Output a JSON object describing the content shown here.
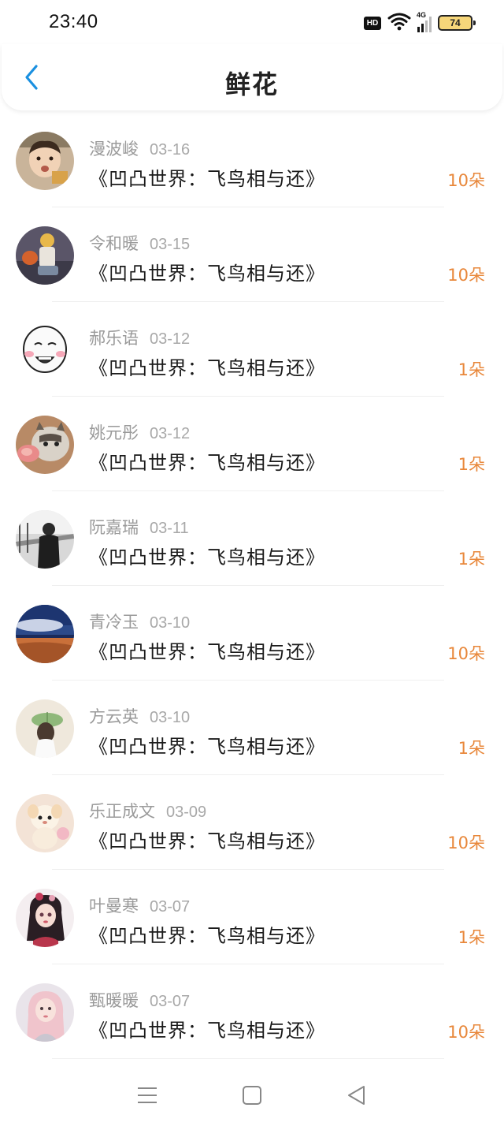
{
  "status_bar": {
    "time": "23:40",
    "hd": "HD",
    "network": "4G",
    "battery": "74"
  },
  "header": {
    "title": "鲜花",
    "back_icon": "chevron-left-icon"
  },
  "colors": {
    "accent": "#e8873a",
    "back": "#1a90e0",
    "username": "#9a9a9a"
  },
  "items": [
    {
      "name": "漫波峻",
      "date": "03-16",
      "title": "《凹凸世界：飞鸟相与还》",
      "amount": "10朵"
    },
    {
      "name": "令和暖",
      "date": "03-15",
      "title": "《凹凸世界：飞鸟相与还》",
      "amount": "10朵"
    },
    {
      "name": "郝乐语",
      "date": "03-12",
      "title": "《凹凸世界：飞鸟相与还》",
      "amount": "1朵"
    },
    {
      "name": "姚元彤",
      "date": "03-12",
      "title": "《凹凸世界：飞鸟相与还》",
      "amount": "1朵"
    },
    {
      "name": "阮嘉瑞",
      "date": "03-11",
      "title": "《凹凸世界：飞鸟相与还》",
      "amount": "1朵"
    },
    {
      "name": "青冷玉",
      "date": "03-10",
      "title": "《凹凸世界：飞鸟相与还》",
      "amount": "10朵"
    },
    {
      "name": "方云英",
      "date": "03-10",
      "title": "《凹凸世界：飞鸟相与还》",
      "amount": "1朵"
    },
    {
      "name": "乐正成文",
      "date": "03-09",
      "title": "《凹凸世界：飞鸟相与还》",
      "amount": "10朵"
    },
    {
      "name": "叶曼寒",
      "date": "03-07",
      "title": "《凹凸世界：飞鸟相与还》",
      "amount": "1朵"
    },
    {
      "name": "甄暖暖",
      "date": "03-07",
      "title": "《凹凸世界：飞鸟相与还》",
      "amount": "10朵"
    }
  ],
  "bottom_nav": [
    "menu-icon",
    "home-square-icon",
    "back-triangle-icon"
  ]
}
